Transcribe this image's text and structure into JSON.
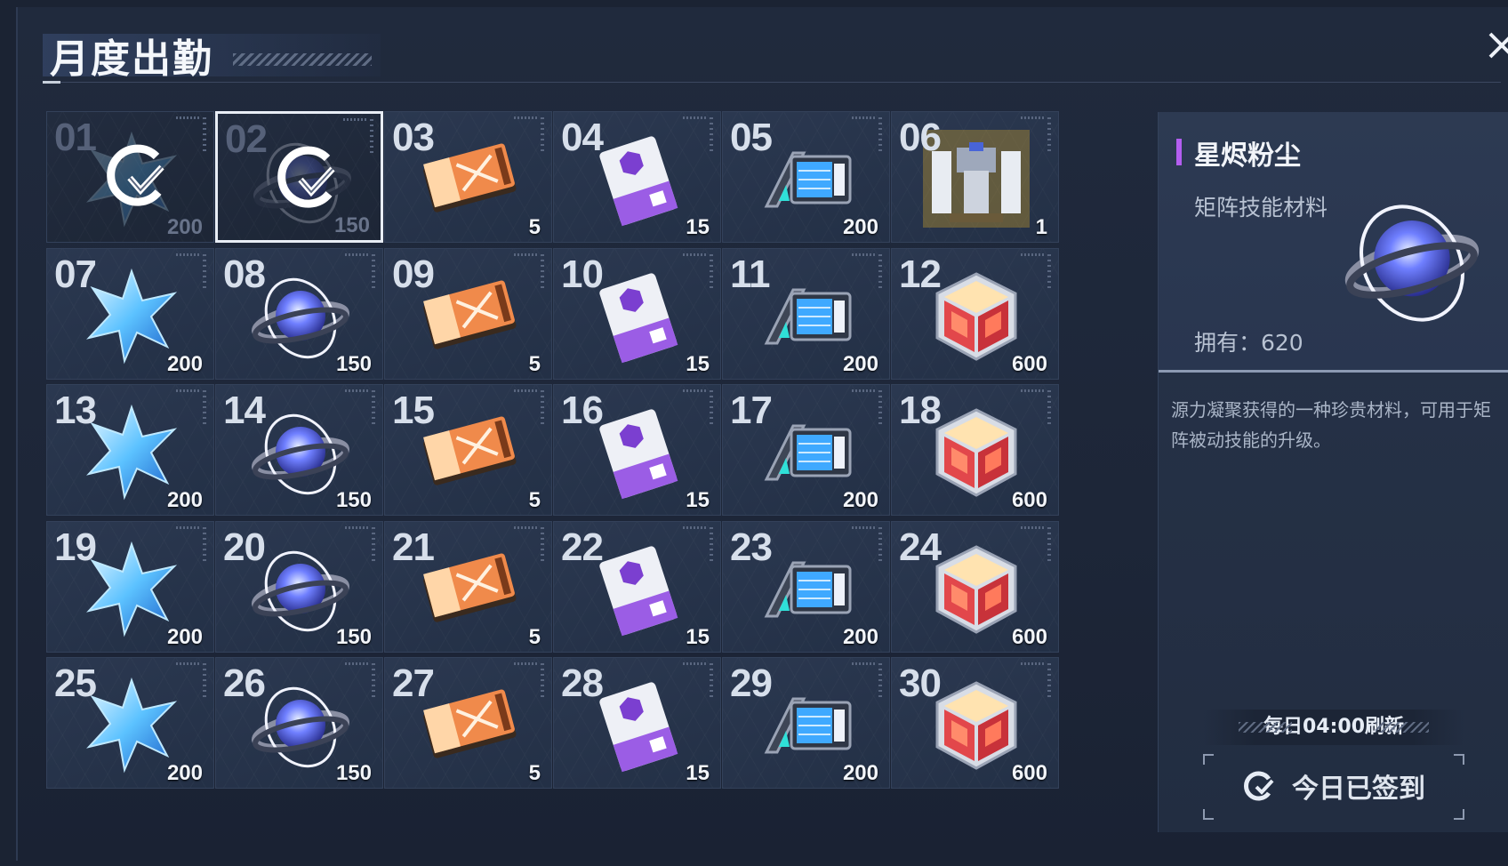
{
  "header": {
    "title": "月度出勤"
  },
  "colors": {
    "accent_purple": "#b35ef0",
    "panel_bg": "#273349",
    "cell_bg": "#2b3850"
  },
  "days": [
    {
      "day": "01",
      "qty": "200",
      "item": "star-icon",
      "claimed": true,
      "selected": false
    },
    {
      "day": "02",
      "qty": "150",
      "item": "orb-icon",
      "claimed": true,
      "selected": true
    },
    {
      "day": "03",
      "qty": "5",
      "item": "ticket-icon",
      "claimed": false,
      "selected": false
    },
    {
      "day": "04",
      "qty": "15",
      "item": "chip-card-icon",
      "claimed": false,
      "selected": false
    },
    {
      "day": "05",
      "qty": "200",
      "item": "data-box-icon",
      "claimed": false,
      "selected": false
    },
    {
      "day": "06",
      "qty": "1",
      "item": "mech-icon",
      "claimed": false,
      "selected": false
    },
    {
      "day": "07",
      "qty": "200",
      "item": "star-icon",
      "claimed": false,
      "selected": false
    },
    {
      "day": "08",
      "qty": "150",
      "item": "orb-icon",
      "claimed": false,
      "selected": false
    },
    {
      "day": "09",
      "qty": "5",
      "item": "ticket-icon",
      "claimed": false,
      "selected": false
    },
    {
      "day": "10",
      "qty": "15",
      "item": "chip-card-icon",
      "claimed": false,
      "selected": false
    },
    {
      "day": "11",
      "qty": "200",
      "item": "data-box-icon",
      "claimed": false,
      "selected": false
    },
    {
      "day": "12",
      "qty": "600",
      "item": "cube-icon",
      "claimed": false,
      "selected": false
    },
    {
      "day": "13",
      "qty": "200",
      "item": "star-icon",
      "claimed": false,
      "selected": false
    },
    {
      "day": "14",
      "qty": "150",
      "item": "orb-icon",
      "claimed": false,
      "selected": false
    },
    {
      "day": "15",
      "qty": "5",
      "item": "ticket-icon",
      "claimed": false,
      "selected": false
    },
    {
      "day": "16",
      "qty": "15",
      "item": "chip-card-icon",
      "claimed": false,
      "selected": false
    },
    {
      "day": "17",
      "qty": "200",
      "item": "data-box-icon",
      "claimed": false,
      "selected": false
    },
    {
      "day": "18",
      "qty": "600",
      "item": "cube-icon",
      "claimed": false,
      "selected": false
    },
    {
      "day": "19",
      "qty": "200",
      "item": "star-icon",
      "claimed": false,
      "selected": false
    },
    {
      "day": "20",
      "qty": "150",
      "item": "orb-icon",
      "claimed": false,
      "selected": false
    },
    {
      "day": "21",
      "qty": "5",
      "item": "ticket-icon",
      "claimed": false,
      "selected": false
    },
    {
      "day": "22",
      "qty": "15",
      "item": "chip-card-icon",
      "claimed": false,
      "selected": false
    },
    {
      "day": "23",
      "qty": "200",
      "item": "data-box-icon",
      "claimed": false,
      "selected": false
    },
    {
      "day": "24",
      "qty": "600",
      "item": "cube-icon",
      "claimed": false,
      "selected": false
    },
    {
      "day": "25",
      "qty": "200",
      "item": "star-icon",
      "claimed": false,
      "selected": false
    },
    {
      "day": "26",
      "qty": "150",
      "item": "orb-icon",
      "claimed": false,
      "selected": false
    },
    {
      "day": "27",
      "qty": "5",
      "item": "ticket-icon",
      "claimed": false,
      "selected": false
    },
    {
      "day": "28",
      "qty": "15",
      "item": "chip-card-icon",
      "claimed": false,
      "selected": false
    },
    {
      "day": "29",
      "qty": "200",
      "item": "data-box-icon",
      "claimed": false,
      "selected": false
    },
    {
      "day": "30",
      "qty": "600",
      "item": "cube-icon",
      "claimed": false,
      "selected": false
    }
  ],
  "detail": {
    "name": "星烬粉尘",
    "type": "矩阵技能材料",
    "owned": "拥有：620",
    "description": "源力凝聚获得的一种珍贵材料，可用于矩阵被动技能的升级。",
    "icon": "orb-icon"
  },
  "footer": {
    "refresh": "每日04:00刷新",
    "signed": "今日已签到"
  }
}
